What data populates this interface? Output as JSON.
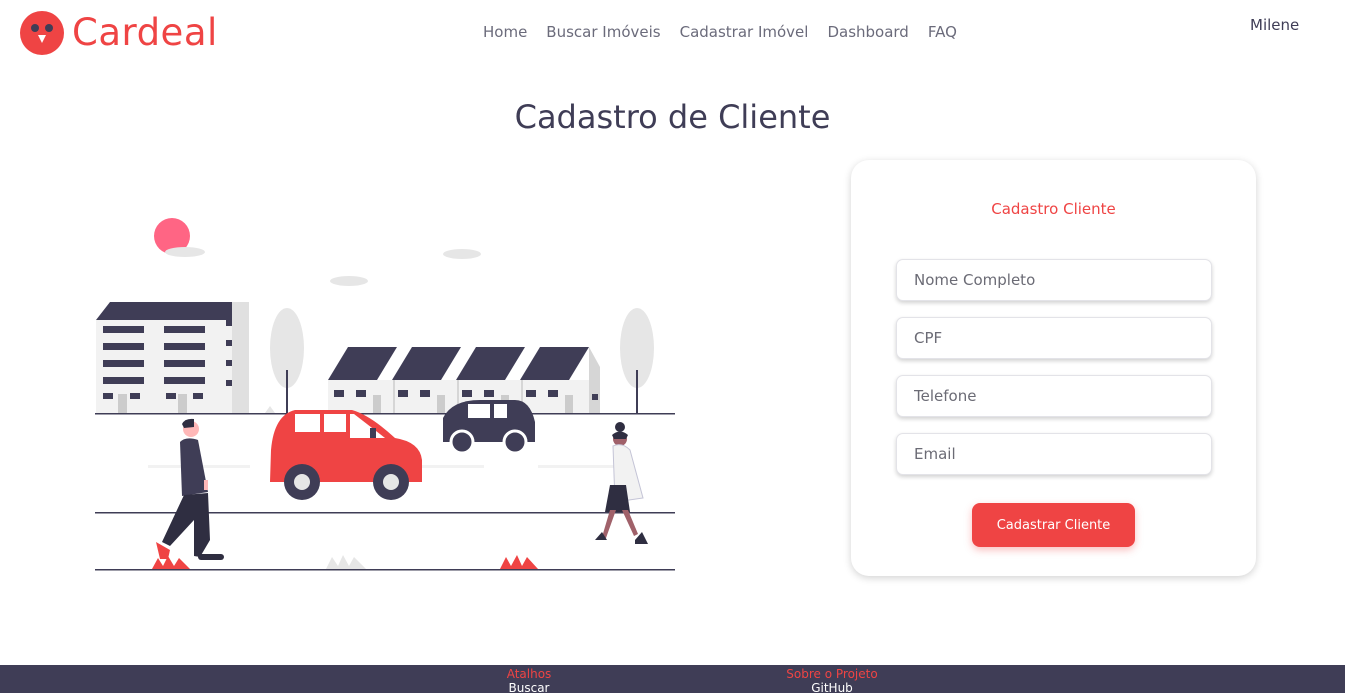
{
  "brand": {
    "name": "Cardeal"
  },
  "nav": {
    "items": [
      "Home",
      "Buscar Imóveis",
      "Cadastrar Imóvel",
      "Dashboard",
      "FAQ"
    ]
  },
  "user": {
    "name": "Milene"
  },
  "page": {
    "title": "Cadastro de Cliente"
  },
  "form": {
    "title": "Cadastro Cliente",
    "fields": [
      {
        "placeholder": "Nome Completo",
        "value": ""
      },
      {
        "placeholder": "CPF",
        "value": ""
      },
      {
        "placeholder": "Telefone",
        "value": ""
      },
      {
        "placeholder": "Email",
        "value": ""
      }
    ],
    "submit_label": "Cadastrar Cliente"
  },
  "footer": {
    "shortcuts": {
      "heading": "Atalhos",
      "first_link": "Buscar Imóvel"
    },
    "about": {
      "heading": "Sobre o Projeto",
      "first_link": "GitHub"
    }
  },
  "colors": {
    "accent": "#ef4444",
    "dark": "#3f3d56",
    "gray": "#e6e6e6"
  }
}
